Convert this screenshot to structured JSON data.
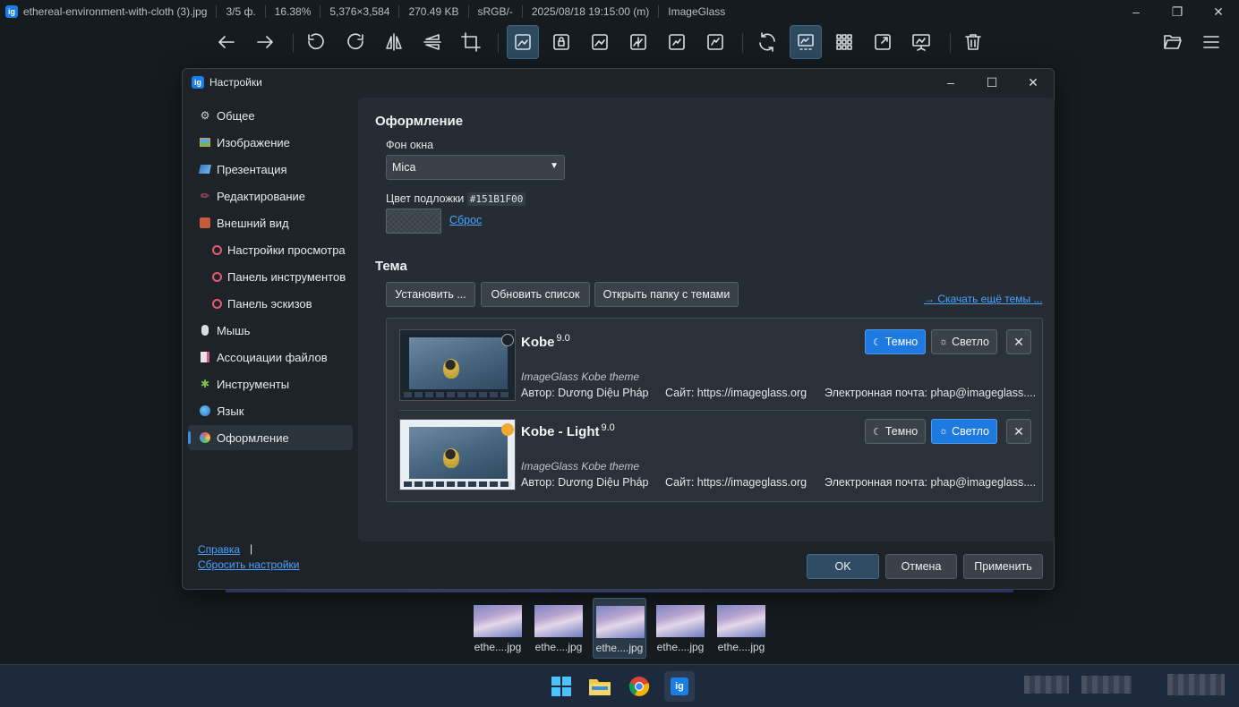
{
  "app": {
    "filename": "ethereal-environment-with-cloth (3).jpg",
    "index": "3/5 ф.",
    "zoom": "16.38%",
    "dimensions": "5,376×3,584",
    "filesize": "270.49 KB",
    "colorspace": "sRGB/-",
    "datetime": "2025/08/18 19:15:00 (m)",
    "appname": "ImageGlass",
    "logo": "ig"
  },
  "toolbar": {
    "icons": [
      "arrow-left-icon",
      "arrow-right-icon",
      "rotate-left-icon",
      "rotate-right-icon",
      "flip-horizontal-icon",
      "flip-vertical-icon",
      "crop-icon",
      "zoom-fit-icon",
      "lock-zoom-icon",
      "scale-width-icon",
      "scale-height-icon",
      "auto-zoom-icon",
      "scale-to-fill-icon",
      "refresh-icon",
      "gallery-icon",
      "checkerboard-icon",
      "fullscreen-icon",
      "slideshow-icon",
      "delete-icon",
      "open-file-icon",
      "menu-icon"
    ]
  },
  "dialog": {
    "title": "Настройки",
    "nav": [
      {
        "label": "Общее",
        "icon": "gear-icon"
      },
      {
        "label": "Изображение",
        "icon": "image-icon"
      },
      {
        "label": "Презентация",
        "icon": "slideshow-icon"
      },
      {
        "label": "Редактирование",
        "icon": "pencil-icon"
      },
      {
        "label": "Внешний вид",
        "icon": "palette-box-icon"
      },
      {
        "label": "Настройки просмотра",
        "icon": "ring-icon"
      },
      {
        "label": "Панель инструментов",
        "icon": "ring-icon"
      },
      {
        "label": "Панель эскизов",
        "icon": "ring-icon"
      },
      {
        "label": "Мышь",
        "icon": "mouse-icon"
      },
      {
        "label": "Ассоциации файлов",
        "icon": "file-icon"
      },
      {
        "label": "Инструменты",
        "icon": "puzzle-icon"
      },
      {
        "label": "Язык",
        "icon": "globe-icon"
      },
      {
        "label": "Оформление",
        "icon": "palette-icon"
      }
    ],
    "help_link": "Справка",
    "reset_link": "Сбросить настройки",
    "section_appearance": "Оформление",
    "window_bg_label": "Фон окна",
    "window_bg_value": "Mica",
    "backdrop_label": "Цвет подложки",
    "backdrop_value": "#151B1F00",
    "reset_color": "Сброс",
    "section_theme": "Тема",
    "btn_install": "Установить ...",
    "btn_refresh": "Обновить список",
    "btn_open_folder": "Открыть папку с темами",
    "download_more": "→ Скачать ещё темы ...",
    "themes": [
      {
        "name": "Kobe",
        "version": "9.0",
        "description": "ImageGlass Kobe theme",
        "author": "Автор: Dương Diệu Pháp",
        "site": "Сайт: https://imageglass.org",
        "email": "Электронная почта: phap@imageglass....",
        "btn_dark": "Темно",
        "btn_light": "Светло",
        "active_mode": "dark"
      },
      {
        "name": "Kobe - Light",
        "version": "9.0",
        "description": "ImageGlass Kobe theme",
        "author": "Автор: Dương Diệu Pháp",
        "site": "Сайт: https://imageglass.org",
        "email": "Электронная почта: phap@imageglass....",
        "btn_dark": "Темно",
        "btn_light": "Светло",
        "active_mode": "light"
      }
    ],
    "btn_ok": "OK",
    "btn_cancel": "Отмена",
    "btn_apply": "Применить"
  },
  "gallery": {
    "items": [
      {
        "label": "ethe....jpg"
      },
      {
        "label": "ethe....jpg"
      },
      {
        "label": "ethe....jpg",
        "selected": true
      },
      {
        "label": "ethe....jpg"
      },
      {
        "label": "ethe....jpg"
      }
    ]
  },
  "colors": {
    "accent": "#1E7AE0",
    "background": "#151B1F",
    "panel": "#252C33"
  }
}
